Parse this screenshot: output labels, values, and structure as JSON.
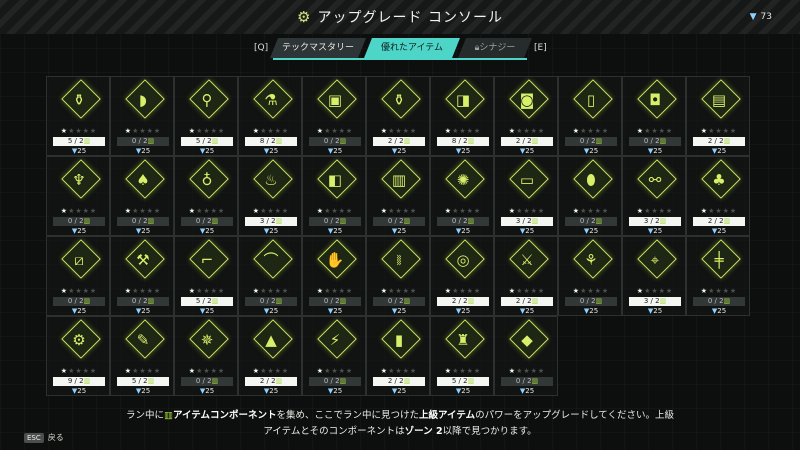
{
  "header": {
    "title": "アップグレード コンソール",
    "currency": "73"
  },
  "tabs": {
    "left_key": "[Q]",
    "right_key": "[E]",
    "items": [
      "テックマスタリー",
      "優れたアイテム",
      "シナジー"
    ],
    "active_index": 1
  },
  "colors": {
    "accent": "#4dd6c8",
    "item_glow": "#c9e25a",
    "currency_icon": "#8fd0ff"
  },
  "items": [
    {
      "icon": "bottle-icon",
      "glyph": "⚱",
      "stars": 1,
      "progress": "5 / 2",
      "full": true,
      "cost": "25"
    },
    {
      "icon": "cookie-icon",
      "glyph": "◗",
      "stars": 1,
      "progress": "0 / 2",
      "full": false,
      "cost": "25"
    },
    {
      "icon": "rattle-icon",
      "glyph": "⚲",
      "stars": 1,
      "progress": "5 / 2",
      "full": true,
      "cost": "25"
    },
    {
      "icon": "potion-icon",
      "glyph": "⚗",
      "stars": 1,
      "progress": "8 / 2",
      "full": true,
      "cost": "25"
    },
    {
      "icon": "toaster-icon",
      "glyph": "▣",
      "stars": 1,
      "progress": "0 / 2",
      "full": false,
      "cost": "25"
    },
    {
      "icon": "beer-bottle-icon",
      "glyph": "⚱",
      "stars": 1,
      "progress": "2 / 2",
      "full": true,
      "cost": "25"
    },
    {
      "icon": "pill-icon",
      "glyph": "◨",
      "stars": 1,
      "progress": "8 / 2",
      "full": true,
      "cost": "25"
    },
    {
      "icon": "jar-icon",
      "glyph": "◙",
      "stars": 1,
      "progress": "2 / 2",
      "full": true,
      "cost": "25"
    },
    {
      "icon": "phone-icon",
      "glyph": "▯",
      "stars": 1,
      "progress": "0 / 2",
      "full": false,
      "cost": "25"
    },
    {
      "icon": "can-icon",
      "glyph": "◘",
      "stars": 1,
      "progress": "0 / 2",
      "full": false,
      "cost": "25"
    },
    {
      "icon": "box-icon",
      "glyph": "▤",
      "stars": 1,
      "progress": "2 / 2",
      "full": true,
      "cost": "25"
    },
    {
      "icon": "spray-bottle-icon",
      "glyph": "♆",
      "stars": 1,
      "progress": "0 / 2",
      "full": false,
      "cost": "25"
    },
    {
      "icon": "onion-icon",
      "glyph": "♠",
      "stars": 1,
      "progress": "0 / 2",
      "full": false,
      "cost": "25"
    },
    {
      "icon": "flask-icon",
      "glyph": "♁",
      "stars": 1,
      "progress": "0 / 2",
      "full": false,
      "cost": "25"
    },
    {
      "icon": "diffuser-icon",
      "glyph": "♨",
      "stars": 1,
      "progress": "3 / 2",
      "full": true,
      "cost": "25"
    },
    {
      "icon": "cup-icon",
      "glyph": "◧",
      "stars": 1,
      "progress": "0 / 2",
      "full": false,
      "cost": "25"
    },
    {
      "icon": "supplement-jar-icon",
      "glyph": "▥",
      "stars": 1,
      "progress": "0 / 2",
      "full": false,
      "cost": "25"
    },
    {
      "icon": "chocolate-icon",
      "glyph": "✺",
      "stars": 1,
      "progress": "0 / 2",
      "full": false,
      "cost": "25"
    },
    {
      "icon": "tray-icon",
      "glyph": "▭",
      "stars": 1,
      "progress": "3 / 2",
      "full": true,
      "cost": "25"
    },
    {
      "icon": "surfboard-icon",
      "glyph": "⬮",
      "stars": 1,
      "progress": "0 / 2",
      "full": false,
      "cost": "25"
    },
    {
      "icon": "vial-icon",
      "glyph": "⚯",
      "stars": 1,
      "progress": "3 / 2",
      "full": true,
      "cost": "25"
    },
    {
      "icon": "bag-icon",
      "glyph": "♣",
      "stars": 1,
      "progress": "2 / 2",
      "full": true,
      "cost": "25"
    },
    {
      "icon": "bar-icon",
      "glyph": "⧄",
      "stars": 1,
      "progress": "0 / 2",
      "full": false,
      "cost": "25"
    },
    {
      "icon": "axe-icon",
      "glyph": "⚒",
      "stars": 1,
      "progress": "0 / 2",
      "full": false,
      "cost": "25"
    },
    {
      "icon": "pistol-icon",
      "glyph": "⌐",
      "stars": 1,
      "progress": "5 / 2",
      "full": true,
      "cost": "25"
    },
    {
      "icon": "boomerang-icon",
      "glyph": "⌒",
      "stars": 1,
      "progress": "0 / 2",
      "full": false,
      "cost": "25"
    },
    {
      "icon": "claw-icon",
      "glyph": "✋",
      "stars": 1,
      "progress": "0 / 2",
      "full": false,
      "cost": "25"
    },
    {
      "icon": "dna-icon",
      "glyph": "⧚",
      "stars": 1,
      "progress": "0 / 2",
      "full": false,
      "cost": "25"
    },
    {
      "icon": "tire-icon",
      "glyph": "◎",
      "stars": 1,
      "progress": "2 / 2",
      "full": true,
      "cost": "25"
    },
    {
      "icon": "knife-icon",
      "glyph": "⚔",
      "stars": 1,
      "progress": "2 / 2",
      "full": true,
      "cost": "25"
    },
    {
      "icon": "water-gun-icon",
      "glyph": "⚘",
      "stars": 1,
      "progress": "0 / 2",
      "full": false,
      "cost": "25"
    },
    {
      "icon": "blaster-icon",
      "glyph": "⌖",
      "stars": 1,
      "progress": "3 / 2",
      "full": true,
      "cost": "25"
    },
    {
      "icon": "rifle-icon",
      "glyph": "╪",
      "stars": 1,
      "progress": "0 / 2",
      "full": false,
      "cost": "25"
    },
    {
      "icon": "gear-orb-icon",
      "glyph": "⚙",
      "stars": 1,
      "progress": "9 / 2",
      "full": true,
      "cost": "25"
    },
    {
      "icon": "syringe-icon",
      "glyph": "✎",
      "stars": 1,
      "progress": "5 / 2",
      "full": true,
      "cost": "25"
    },
    {
      "icon": "robot-bug-icon",
      "glyph": "✵",
      "stars": 1,
      "progress": "0 / 2",
      "full": false,
      "cost": "25"
    },
    {
      "icon": "cone-icon",
      "glyph": "▲",
      "stars": 1,
      "progress": "2 / 2",
      "full": true,
      "cost": "25"
    },
    {
      "icon": "battery-icon",
      "glyph": "⚡",
      "stars": 1,
      "progress": "0 / 2",
      "full": false,
      "cost": "25"
    },
    {
      "icon": "battery-pack-icon",
      "glyph": "▮",
      "stars": 1,
      "progress": "2 / 2",
      "full": true,
      "cost": "25"
    },
    {
      "icon": "robot-icon",
      "glyph": "♜",
      "stars": 1,
      "progress": "5 / 2",
      "full": true,
      "cost": "25"
    },
    {
      "icon": "spray-can-icon",
      "glyph": "◆",
      "stars": 1,
      "progress": "0 / 2",
      "full": false,
      "cost": "25"
    }
  ],
  "description": {
    "part1": "ラン中に",
    "part2": "アイテムコンポーネント",
    "part3": "を集め、ここでラン中に見つけた",
    "part4": "上級アイテム",
    "part5": "のパワーをアップグレードしてください。上級アイテム",
    "part6": "とそのコンポーネントは",
    "part7": "ゾーン 2",
    "part8": "以降で見つかります。"
  },
  "footer": {
    "esc_key": "ESC",
    "back_label": "戻る"
  }
}
